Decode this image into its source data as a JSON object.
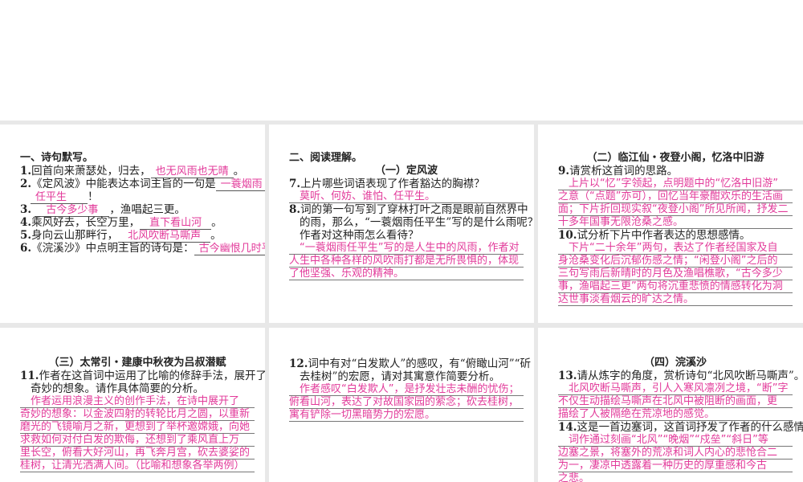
{
  "accent_color": "#e23a9a",
  "panel1": {
    "heading": "一、诗句默写。",
    "items": [
      {
        "num": "1.",
        "pre": "回首向来萧瑟处，归去，",
        "blank": "也无风雨也无晴",
        "post": "。"
      },
      {
        "num": "2.",
        "pre": "《定风波》中能表达本词主旨的一句是",
        "blank": "一蓑烟雨",
        "blank2": "任平生",
        "post": "！"
      },
      {
        "num": "3.",
        "pre": "",
        "blank": "古今多少事",
        "post": "，渔唱起三更。"
      },
      {
        "num": "4.",
        "pre": "乘风好去，长空万里，",
        "blank": "直下看山河",
        "post": "。"
      },
      {
        "num": "5.",
        "pre": "身向云山那畔行，",
        "blank": "北风吹断马嘶声",
        "post": "。"
      },
      {
        "num": "6.",
        "pre": "《浣溪沙》中点明主旨的诗句是：",
        "blank": "古今幽恨几时平",
        "post": "！"
      }
    ]
  },
  "panel2": {
    "heading": "二、阅读理解。",
    "subtitle": "（一）定风波",
    "q7": {
      "num": "7.",
      "lines": [
        "上片哪些词语表现了作者豁达的胸襟？"
      ],
      "answer": [
        "莫听、何妨、谁怕、任平生。"
      ]
    },
    "q8": {
      "num": "8.",
      "lines": [
        "词的第一句写到了穿林打叶之雨是眼前自然界中",
        "的雨，那么，“一蓑烟雨任平生”写的是什么雨呢？",
        "作者对这种雨怎么看待？"
      ],
      "answer": [
        "“一蓑烟雨任平生”写的是人生中的风雨，作者对",
        "人生中各种各样的风吹雨打都是无所畏惧的，体现",
        "了他坚强、乐观的精神。"
      ]
    }
  },
  "panel3": {
    "subtitle": "（二）临江仙・夜登小阁，忆洛中旧游",
    "q9": {
      "num": "9.",
      "lines": [
        "请赏析这首词的思路。"
      ],
      "answer": [
        "上片以“忆”字领起，点明题中的“忆洛中旧游”",
        "之意（“点题”亦可），回忆当年豪酣欢乐的生活画",
        "面；下片折回现实叙“夜登小阁”所见所闻，抒发二",
        "十多年国事无限沧桑之感。"
      ]
    },
    "q10": {
      "num": "10.",
      "lines": [
        "试分析下片中作者表达的思想感情。"
      ],
      "answer": [
        "下片“二十余年”两句，表达了作者经国家及自",
        "身沧桑变化后沉郁伤感之情；“闲登小阁”之后的",
        "三句写雨后新晴时的月色及渔唱樵歌，“古今多少",
        "事，渔唱起三更”两句将沉重悲愤的情感转化为洞",
        "达世事淡看烟云的旷达之情。"
      ]
    }
  },
  "panel4": {
    "subtitle": "（三）太常引・建康中秋夜为吕叔潜赋",
    "q11": {
      "num": "11.",
      "lines": [
        "作者在这首词中运用了比喻的修辞手法，展开了",
        "奇妙的想象。请作具体简要的分析。"
      ],
      "answer": [
        "作者运用浪漫主义的创作手法，在诗中展开了",
        "奇妙的想象：以金波四射的转轮比月之圆，以重新",
        "磨光的飞镜喻月之新，更想到了举杯邀嫦娥，向她",
        "求救如何对付白发的欺侮，还想到了乘风直上万",
        "里长空，俯看大好河山，再飞奔月宫，砍去婆娑的",
        "桂树，让清光洒满人间。（比喻和想象各举两例）"
      ]
    }
  },
  "panel5": {
    "q12": {
      "num": "12.",
      "lines": [
        "词中有对“白发欺人”的感叹，有“俯瞰山河”“斫",
        "去桂树”的宏愿，请对其寓意作简要分析。"
      ],
      "answer": [
        "作者感叹“白发欺人”，是抒发壮志未酬的忧伤；",
        "俯看山河，表达了对故国家园的萦念；砍去桂树，",
        "寓有铲除一切黑暗势力的宏愿。"
      ]
    }
  },
  "panel6": {
    "subtitle": "（四）浣溪沙",
    "q13": {
      "num": "13.",
      "lines": [
        "请从炼字的角度，赏析诗句“北风吹断马嘶声”。"
      ],
      "answer": [
        "北风吹断马嘶声，引人入寒风凛冽之境，“断”字",
        "不仅生动描绘马嘶声在北风中被阻断的画面，更",
        "描绘了人被隔绝在荒凉地的感觉。"
      ]
    },
    "q14": {
      "num": "14.",
      "lines": [
        "这是一首边塞词，这首词抒发了作者的什么感情？"
      ],
      "answer": [
        "词作通过刻画“北风”“晚烟”“戍垒”“斜日”等",
        "边塞之景，将塞外的荒凉和词人内心的悲怆合二",
        "为一，凄凉中透露着一种历史的厚重感和今古",
        "之悲。"
      ]
    }
  }
}
